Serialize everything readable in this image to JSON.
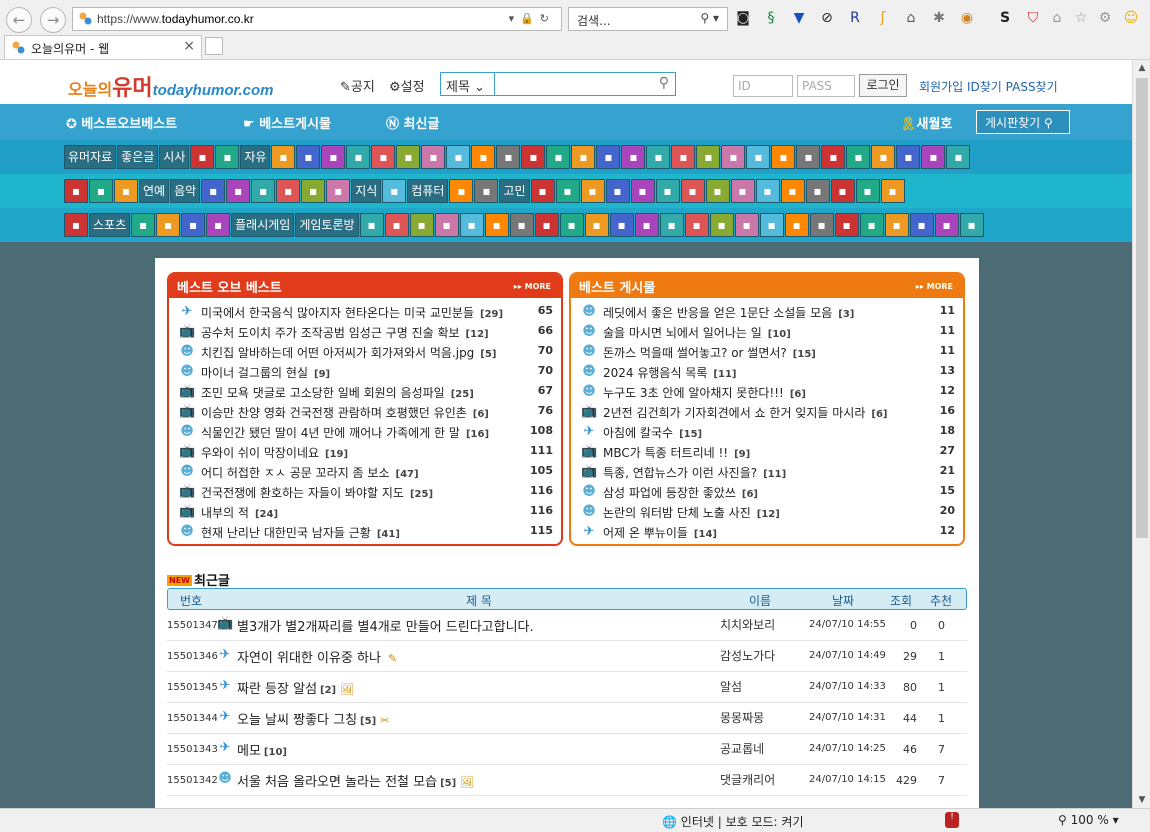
{
  "browser": {
    "back": "←",
    "forward": "→",
    "url_prefix": "https://www.",
    "url_host": "todayhumor.co.kr",
    "search_placeholder": "검색...",
    "tab_title": "오늘의유머 - 웹",
    "tab_close": "×",
    "status_zone": "인터넷 | 보호 모드: 켜기",
    "zoom": "100 %"
  },
  "header": {
    "logo_a": "오늘의",
    "logo_b": "유머",
    "logo_c": "todayhumor.com",
    "notice": "공지",
    "settings": "설정",
    "search_category": "제목 ⌄",
    "id_placeholder": "ID",
    "pass_placeholder": "PASS",
    "login": "로그인",
    "links": "회원가입 ID찾기 PASS찾기"
  },
  "nav": {
    "best_of_best": "베스트오브베스트",
    "best_board": "베스트게시물",
    "latest": "최신글",
    "new_issue": "새월호",
    "board_find": "게시판찾기"
  },
  "nav_row2": [
    "유머자료",
    "좋은글",
    "시사"
  ],
  "nav_row2b": [
    "자유"
  ],
  "nav_row3": [
    "연예",
    "음악"
  ],
  "nav_row3b": [
    "지식"
  ],
  "nav_row3c": [
    "컴퓨터"
  ],
  "nav_row3d": [
    "고민"
  ],
  "nav_row4": [
    "스포츠"
  ],
  "nav_row4b": [
    "플래시게임",
    "게임토론방"
  ],
  "best_of_best": {
    "title": "베스트 오브 베스트",
    "more": "▸▸ MORE",
    "items": [
      {
        "title": "미국에서 한국음식 많아지자 현타온다는 미국 교민분들",
        "comments": "[29]",
        "num": "65",
        "icon": "✈"
      },
      {
        "title": "공수처 도이치 주가 조작공범 임성근 구명 진술 확보",
        "comments": "[12]",
        "num": "66",
        "icon": "📺"
      },
      {
        "title": "치킨집 알바하는데 어떤 아저씨가 회가져와서 먹음.jpg",
        "comments": "[5]",
        "num": "70",
        "icon": "☻"
      },
      {
        "title": "마이너 걸그룹의 현실",
        "comments": "[9]",
        "num": "70",
        "icon": "☻"
      },
      {
        "title": "조민 모욕 댓글로 고소당한 일베 회원의 음성파일",
        "comments": "[25]",
        "num": "67",
        "icon": "📺"
      },
      {
        "title": "이승만 찬양 영화 건국전쟁 관람하며 호평했던 유인촌",
        "comments": "[6]",
        "num": "76",
        "icon": "📺"
      },
      {
        "title": "식물인간 됐던 딸이 4년 만에 깨어나 가족에게 한 말",
        "comments": "[16]",
        "num": "108",
        "icon": "☻"
      },
      {
        "title": "우와이 쉬이 막장이네요",
        "comments": "[19]",
        "num": "111",
        "icon": "📺"
      },
      {
        "title": "어디 허접한 ㅈㅅ 공문 꼬라지 좀 보소",
        "comments": "[47]",
        "num": "105",
        "icon": "☻"
      },
      {
        "title": "건국전쟁에 환호하는 자들이 봐야할 지도",
        "comments": "[25]",
        "num": "116",
        "icon": "📺"
      },
      {
        "title": "내부의 적",
        "comments": "[24]",
        "num": "116",
        "icon": "📺"
      },
      {
        "title": "현재 난리난 대한민국 남자들 근황",
        "comments": "[41]",
        "num": "115",
        "icon": "☻"
      }
    ]
  },
  "best_board": {
    "title": "베스트 게시물",
    "more": "▸▸ MORE",
    "items": [
      {
        "title": "레딧에서 좋은 반응을 얻은 1문단 소설들 모음",
        "comments": "[3]",
        "num": "11",
        "icon": "☻"
      },
      {
        "title": "술을 마시면 뇌에서 일어나는 일",
        "comments": "[10]",
        "num": "11",
        "icon": "☻"
      },
      {
        "title": "돈까스 먹을때 썰어놓고? or 썰면서?",
        "comments": "[15]",
        "num": "11",
        "icon": "☻"
      },
      {
        "title": "2024 유행음식 목록",
        "comments": "[11]",
        "num": "13",
        "icon": "☻"
      },
      {
        "title": "누구도 3초 안에 알아채지 못한다!!!",
        "comments": "[6]",
        "num": "12",
        "icon": "☻"
      },
      {
        "title": "2년전 김건희가 기자회견에서 쇼 한거 잊지들 마시라",
        "comments": "[6]",
        "num": "16",
        "icon": "📺"
      },
      {
        "title": "아침에 칼국수",
        "comments": "[15]",
        "num": "18",
        "icon": "✈"
      },
      {
        "title": "MBC가 특종 터트리네 !!",
        "comments": "[9]",
        "num": "27",
        "icon": "📺"
      },
      {
        "title": "특종, 연합뉴스가 이런 사진을?",
        "comments": "[11]",
        "num": "21",
        "icon": "📺"
      },
      {
        "title": "삼성 파업에 등장한 좋았쓰",
        "comments": "[6]",
        "num": "15",
        "icon": "☻"
      },
      {
        "title": "논란의 워터밤 단체 노출 사진",
        "comments": "[12]",
        "num": "20",
        "icon": "☻"
      },
      {
        "title": "어제 온 뿌뉴이들",
        "comments": "[14]",
        "num": "12",
        "icon": "✈"
      }
    ]
  },
  "latest": {
    "badge": "NEW",
    "title": "최근글",
    "columns": {
      "no": "번호",
      "title": "제 목",
      "name": "이름",
      "date": "날짜",
      "views": "조회",
      "rec": "추천"
    },
    "rows": [
      {
        "no": "15501347",
        "icon": "📺",
        "title": "별3개가 별2개짜리를 별4개로 만들어 드린다고합니다.",
        "comments": "",
        "extra": "",
        "name": "치치와보리",
        "date": "24/07/10 14:55",
        "views": "0",
        "rec": "0"
      },
      {
        "no": "15501346",
        "icon": "✈",
        "title": "자연이 위대한 이유중 하나",
        "comments": "",
        "extra": "✎",
        "name": "감성노가다",
        "date": "24/07/10 14:49",
        "views": "29",
        "rec": "1"
      },
      {
        "no": "15501345",
        "icon": "✈",
        "title": "짜란 등장 알섬",
        "comments": "[2]",
        "extra": "🖼",
        "name": "알섬",
        "date": "24/07/10 14:33",
        "views": "80",
        "rec": "1"
      },
      {
        "no": "15501344",
        "icon": "✈",
        "title": "오늘 날씨 짱좋다 그칭",
        "comments": "[5]",
        "extra": "✂",
        "name": "몽몽짜몽",
        "date": "24/07/10 14:31",
        "views": "44",
        "rec": "1"
      },
      {
        "no": "15501343",
        "icon": "✈",
        "title": "메모",
        "comments": "[10]",
        "extra": "",
        "name": "공교롭네",
        "date": "24/07/10 14:25",
        "views": "46",
        "rec": "7"
      },
      {
        "no": "15501342",
        "icon": "☻",
        "title": "서울 처음 올라오면 놀라는 전철 모습",
        "comments": "[5]",
        "extra": "🖼",
        "name": "댓글캐리어",
        "date": "24/07/10 14:15",
        "views": "429",
        "rec": "7"
      }
    ]
  },
  "colors": {
    "bob": "#e03c1c",
    "board": "#f07a12",
    "nav": "#36a2cf"
  }
}
